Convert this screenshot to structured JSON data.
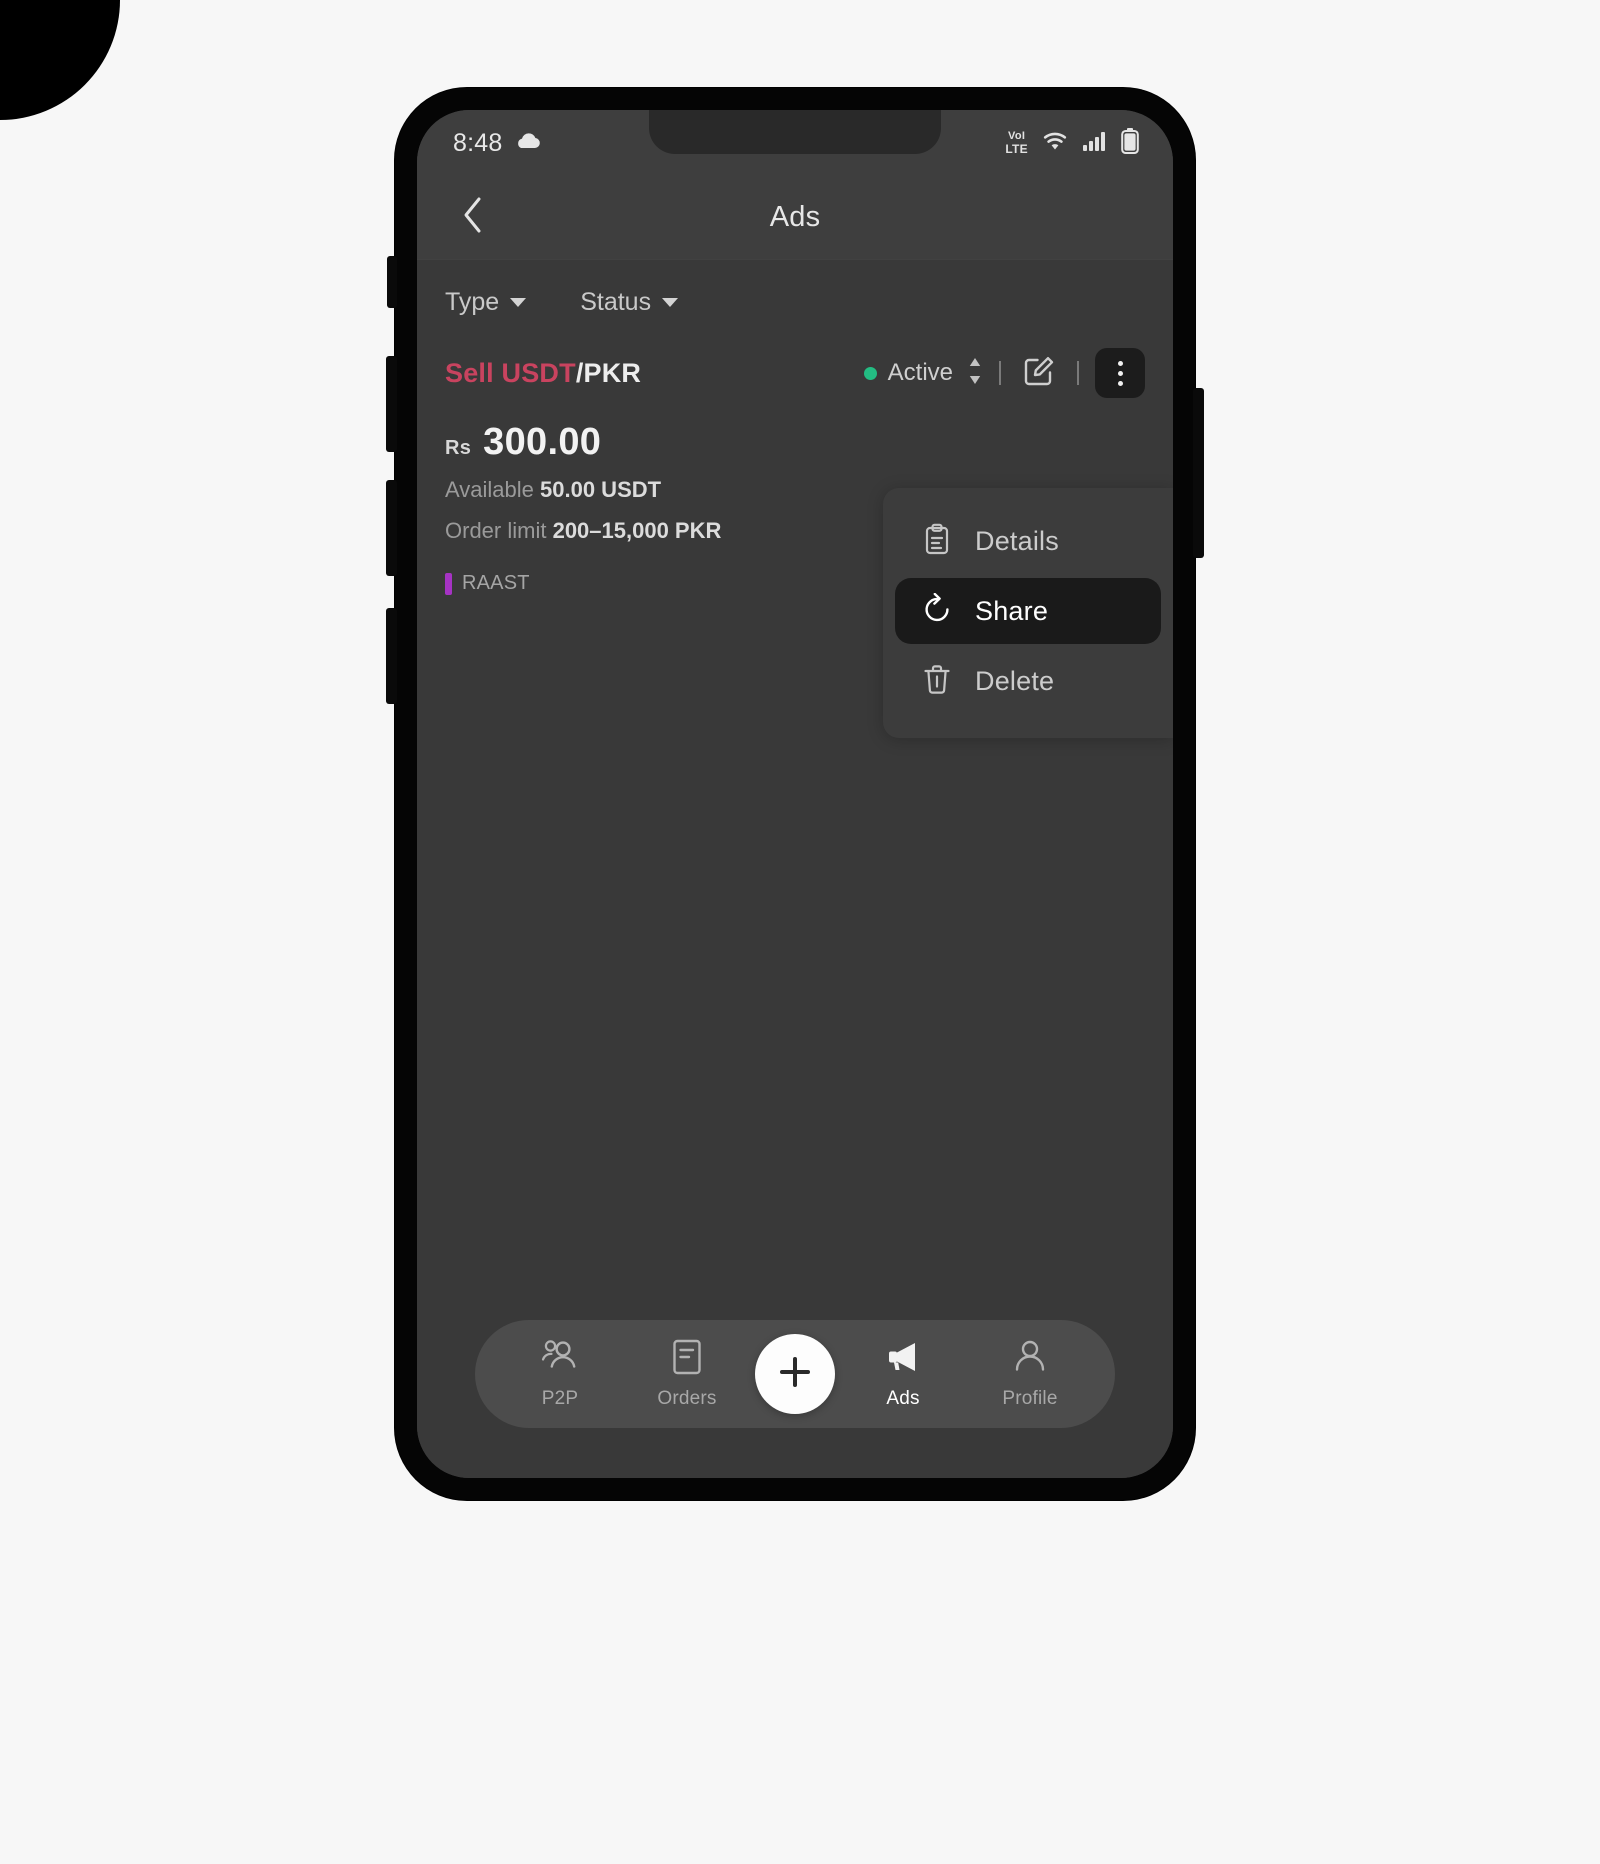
{
  "statusbar": {
    "time": "8:48",
    "weather_icon": "cloud-icon",
    "volte_top": "VoLTE",
    "volte_line1": "VoI",
    "volte_line2": "LTE",
    "wifi_icon": "wifi-icon",
    "signal_icon": "cellular-signal-icon",
    "battery_icon": "battery-icon"
  },
  "appbar": {
    "back_icon": "chevron-left-icon",
    "title": "Ads"
  },
  "filters": [
    {
      "label": "Type",
      "icon": "chevron-down-icon"
    },
    {
      "label": "Status",
      "icon": "chevron-down-icon"
    }
  ],
  "ad": {
    "side": "Sell USDT",
    "quote": "/PKR",
    "status_label": "Active",
    "status_color": "#23bd83",
    "sort_icon": "up-down-arrows-icon",
    "edit_icon": "edit-square-icon",
    "more_icon": "kebab-menu-icon",
    "currency_symbol": "Rs",
    "price": "300.00",
    "available_label": "Available",
    "available_value": "50.00 USDT",
    "order_limit_label": "Order limit",
    "order_limit_value": "200–15,000 PKR",
    "payment_methods": [
      {
        "name": "RAAST",
        "color": "#a633c4"
      }
    ]
  },
  "menu": {
    "items": [
      {
        "label": "Details",
        "icon": "clipboard-icon",
        "active": false
      },
      {
        "label": "Share",
        "icon": "share-circle-icon",
        "active": true
      },
      {
        "label": "Delete",
        "icon": "trash-icon",
        "active": false
      }
    ]
  },
  "bottom_nav": {
    "items": [
      {
        "label": "P2P",
        "icon": "people-icon",
        "active": false
      },
      {
        "label": "Orders",
        "icon": "document-icon",
        "active": false
      },
      {
        "label": "Ads",
        "icon": "megaphone-icon",
        "active": true
      },
      {
        "label": "Profile",
        "icon": "person-icon",
        "active": false
      }
    ],
    "fab_icon": "plus-icon"
  },
  "colors": {
    "page_background": "#f7f7f7",
    "phone_frame": "#050505",
    "screen_background": "#393939",
    "appbar_background": "#3e3e3e",
    "sell_accent": "#c9435f",
    "active_green": "#23bd83",
    "raast_purple": "#a633c4",
    "nav_pill": "#4c4c4c",
    "menu_highlight": "#1a1a1a"
  }
}
